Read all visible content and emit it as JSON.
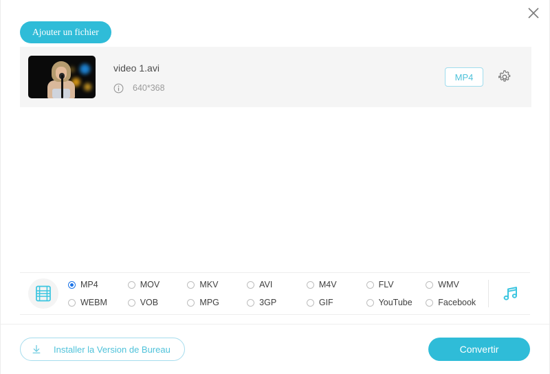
{
  "window": {
    "close_icon": "close-icon"
  },
  "toolbar": {
    "add_file_label": "Ajouter un fichier"
  },
  "file_list": {
    "items": [
      {
        "name": "video 1.avi",
        "resolution": "640*368",
        "info_icon": "info-circle-icon",
        "format_badge": "MP4",
        "settings_icon": "gear-icon",
        "thumbnail": "video-thumbnail"
      }
    ]
  },
  "format_picker": {
    "video_icon": "film-strip-icon",
    "audio_icon": "music-note-icon",
    "selected": "MP4",
    "options": [
      "MP4",
      "MOV",
      "MKV",
      "AVI",
      "M4V",
      "FLV",
      "WMV",
      "WEBM",
      "VOB",
      "MPG",
      "3GP",
      "GIF",
      "YouTube",
      "Facebook"
    ]
  },
  "bottom_bar": {
    "install_label": "Installer la Version de Bureau",
    "install_icon": "download-icon",
    "convert_label": "Convertir"
  },
  "colors": {
    "accent": "#2fbcd8",
    "accent_light": "#4fc2da",
    "radio_selected": "#1a73e8",
    "row_bg": "#f5f5f5"
  }
}
